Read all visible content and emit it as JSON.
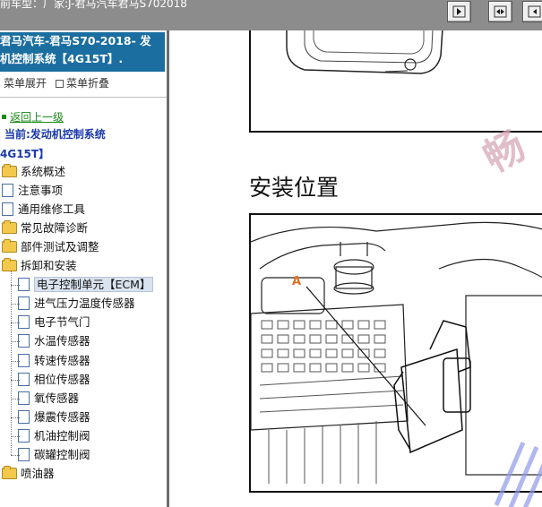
{
  "header": {
    "title": "前车型：厂家:J-君马汽车君马S702018"
  },
  "toolbar": {
    "buttons": [
      "prev-page-icon",
      "fit-width-icon",
      "next-page-icon"
    ]
  },
  "sidebar": {
    "title_line1": "君马汽车-君马S70-2018- 发",
    "title_line2": "机控制系统【4G15T】.",
    "expand_label": "菜单展开",
    "collapse_label": "菜单折叠",
    "back_label": "返回上一级",
    "current_line1": "当前:发动机控制系统",
    "current_line2": "4G15T】",
    "items": [
      {
        "label": "系统概述",
        "type": "folder"
      },
      {
        "label": "注意事项",
        "type": "doc"
      },
      {
        "label": "通用维修工具",
        "type": "doc"
      },
      {
        "label": "常见故障诊断",
        "type": "folder"
      },
      {
        "label": "部件测试及调整",
        "type": "folder"
      },
      {
        "label": "拆卸和安装",
        "type": "folder",
        "open": true
      },
      {
        "label": "电子控制单元【ECM】",
        "type": "doc",
        "child": true,
        "selected": true
      },
      {
        "label": "进气压力温度传感器",
        "type": "doc",
        "child": true
      },
      {
        "label": "电子节气门",
        "type": "doc",
        "child": true
      },
      {
        "label": "水温传感器",
        "type": "doc",
        "child": true
      },
      {
        "label": "转速传感器",
        "type": "doc",
        "child": true
      },
      {
        "label": "相位传感器",
        "type": "doc",
        "child": true
      },
      {
        "label": "氧传感器",
        "type": "doc",
        "child": true
      },
      {
        "label": "爆震传感器",
        "type": "doc",
        "child": true
      },
      {
        "label": "机油控制阀",
        "type": "doc",
        "child": true
      },
      {
        "label": "碳罐控制阀",
        "type": "doc",
        "child": true
      },
      {
        "label": "喷油器",
        "type": "folder"
      }
    ]
  },
  "main": {
    "section_heading": "安装位置",
    "figure_callout": "A",
    "watermark_text": "畅",
    "accent_color": "#1b6ea0",
    "callout_color": "#e07020"
  }
}
